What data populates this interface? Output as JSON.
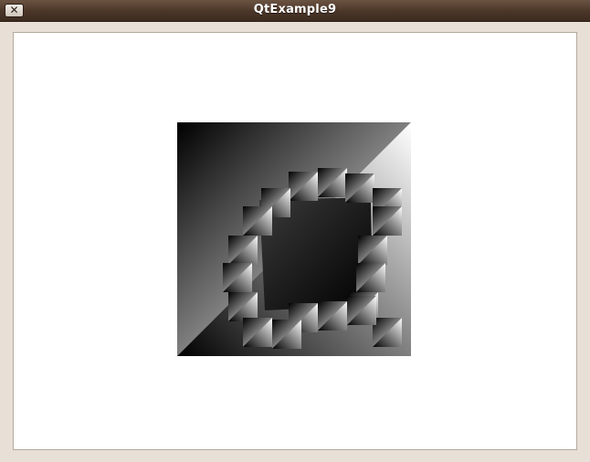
{
  "window": {
    "title": "QtExample9",
    "close_glyph": "✕",
    "close_icon": "close-icon"
  },
  "canvas": {
    "description_colors": {
      "dark": "#000000",
      "light": "#ffffff",
      "titlebar": "#4a3528",
      "frame": "#e8dfd6"
    }
  }
}
